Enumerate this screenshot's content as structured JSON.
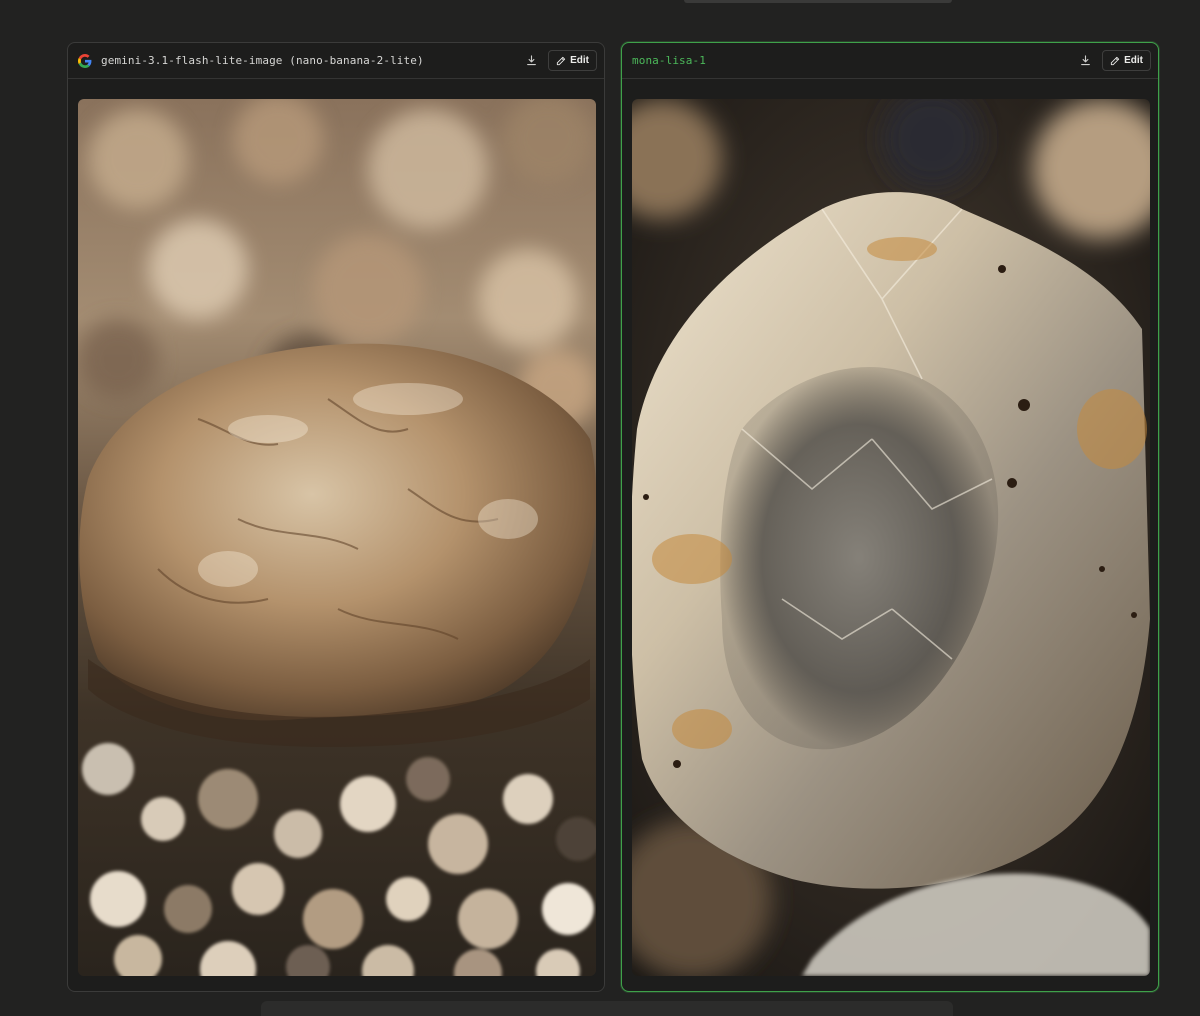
{
  "panels": [
    {
      "model_name": "gemini-3.1-flash-lite-image (nano-banana-2-lite)",
      "brand_icon": "google-g-icon",
      "download_icon": "download-icon",
      "edit_label": "Edit",
      "selected": false
    },
    {
      "model_name": "mona-lisa-1",
      "download_icon": "download-icon",
      "edit_label": "Edit",
      "selected": true,
      "accent_color": "#3fa14a"
    }
  ]
}
